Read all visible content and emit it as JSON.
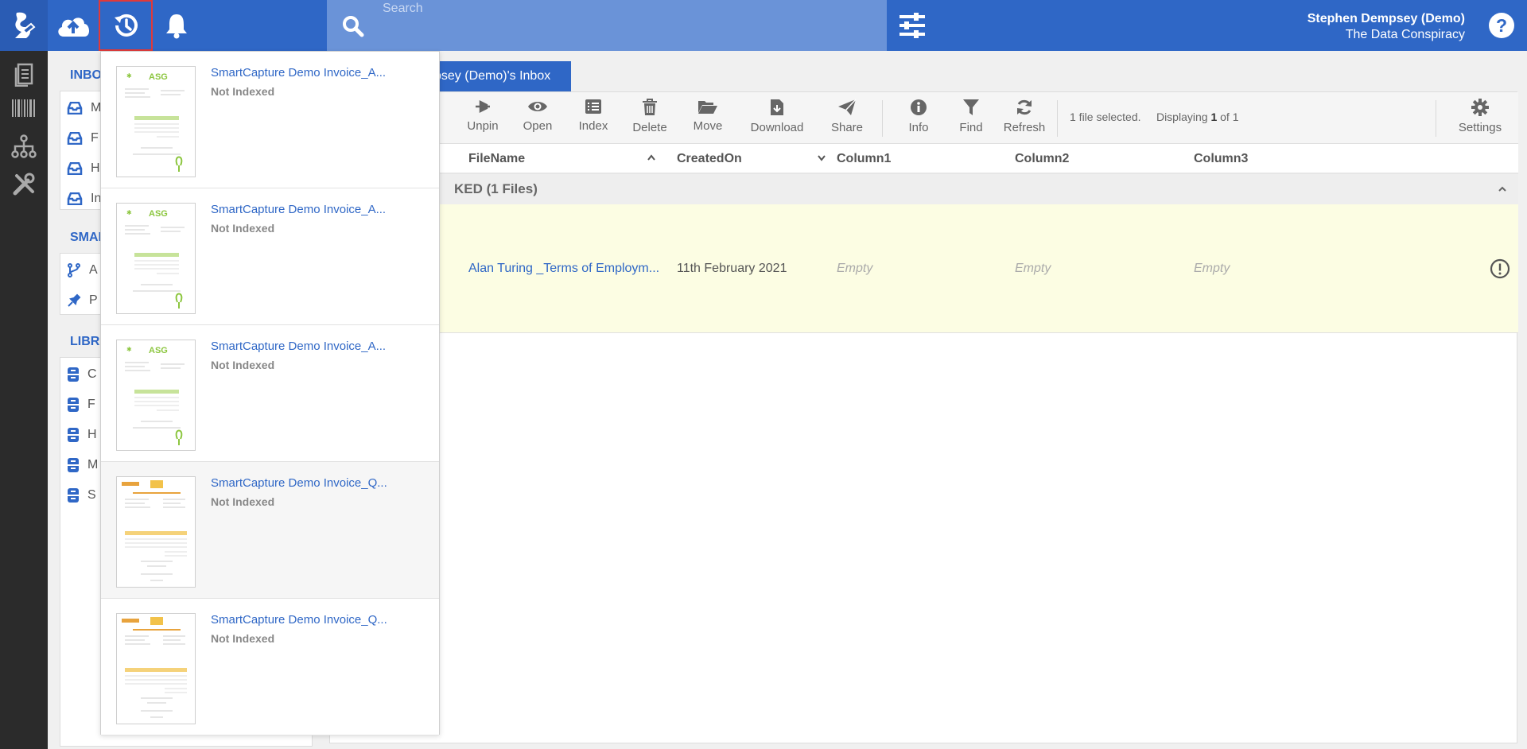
{
  "header": {
    "search_placeholder": "Search",
    "user_name": "Stephen Dempsey (Demo)",
    "user_org": "The Data Conspiracy",
    "icons": [
      "app-logo-icon",
      "cloud-upload-icon",
      "history-icon",
      "bell-icon",
      "search-icon",
      "filter-sliders-icon",
      "help-icon"
    ]
  },
  "rail": {
    "icons": [
      "documents-icon",
      "barcode-icon",
      "workflow-tree-icon",
      "tools-icon"
    ]
  },
  "sidebar": {
    "sections": [
      {
        "title": "INBO",
        "items": [
          "M",
          "F",
          "H",
          "In"
        ]
      },
      {
        "title": "SMAI",
        "items": [
          "A",
          "P"
        ]
      },
      {
        "title": "LIBR",
        "items": [
          "C",
          "F",
          "H",
          "M",
          "S"
        ]
      }
    ]
  },
  "main": {
    "tab_label": "psey (Demo)'s Inbox",
    "toolbar": {
      "partial_label": "n",
      "buttons": [
        "Unpin",
        "Open",
        "Index",
        "Delete",
        "Move",
        "Download",
        "Share",
        "Info",
        "Find",
        "Refresh",
        "Settings"
      ],
      "status_selected": "1 file selected.",
      "status_displaying": "Displaying",
      "status_page": "1",
      "status_of": "of 1"
    },
    "columns": [
      "FileName",
      "CreatedOn",
      "Column1",
      "Column2",
      "Column3"
    ],
    "group_label": "KED  (1 Files)",
    "row": {
      "filename": "Alan Turing _Terms of Employm...",
      "created_on": "11th February 2021",
      "column1": "Empty",
      "column2": "Empty",
      "column3": "Empty"
    }
  },
  "history": {
    "items": [
      {
        "title": "SmartCapture Demo Invoice_A...",
        "status": "Not Indexed",
        "thumb": "green"
      },
      {
        "title": "SmartCapture Demo Invoice_A...",
        "status": "Not Indexed",
        "thumb": "green"
      },
      {
        "title": "SmartCapture Demo Invoice_A...",
        "status": "Not Indexed",
        "thumb": "green"
      },
      {
        "title": "SmartCapture Demo Invoice_Q...",
        "status": "Not Indexed",
        "thumb": "orange"
      },
      {
        "title": "SmartCapture Demo Invoice_Q...",
        "status": "Not Indexed",
        "thumb": "orange"
      }
    ]
  },
  "colors": {
    "brand_blue": "#2f67c6",
    "rail_dark": "#2b2b2b",
    "selected_row": "#fcfde3",
    "highlight_red": "#e03a3a"
  }
}
